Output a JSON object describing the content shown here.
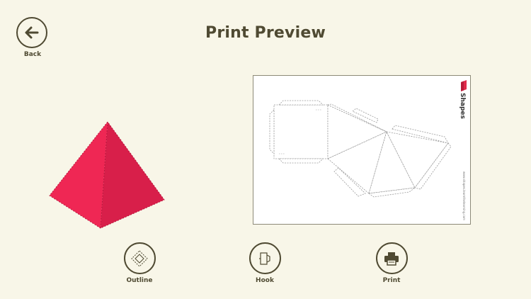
{
  "header": {
    "title": "Print Preview",
    "back_label": "Back"
  },
  "paper": {
    "brand_name": "Shapes",
    "brand_url": "www.shapes.learnthelearning.com"
  },
  "toolbar": {
    "items": [
      {
        "label": "Outline",
        "icon": "outline-diamond-icon"
      },
      {
        "label": "Hook",
        "icon": "hook-tab-icon"
      },
      {
        "label": "Print",
        "icon": "printer-icon"
      }
    ]
  },
  "colors": {
    "background": "#f8f6e8",
    "ink": "#4f4a32",
    "pyramid_front": "#ef2754",
    "pyramid_side": "#d81f4a",
    "brand_red": "#e02a4a"
  }
}
